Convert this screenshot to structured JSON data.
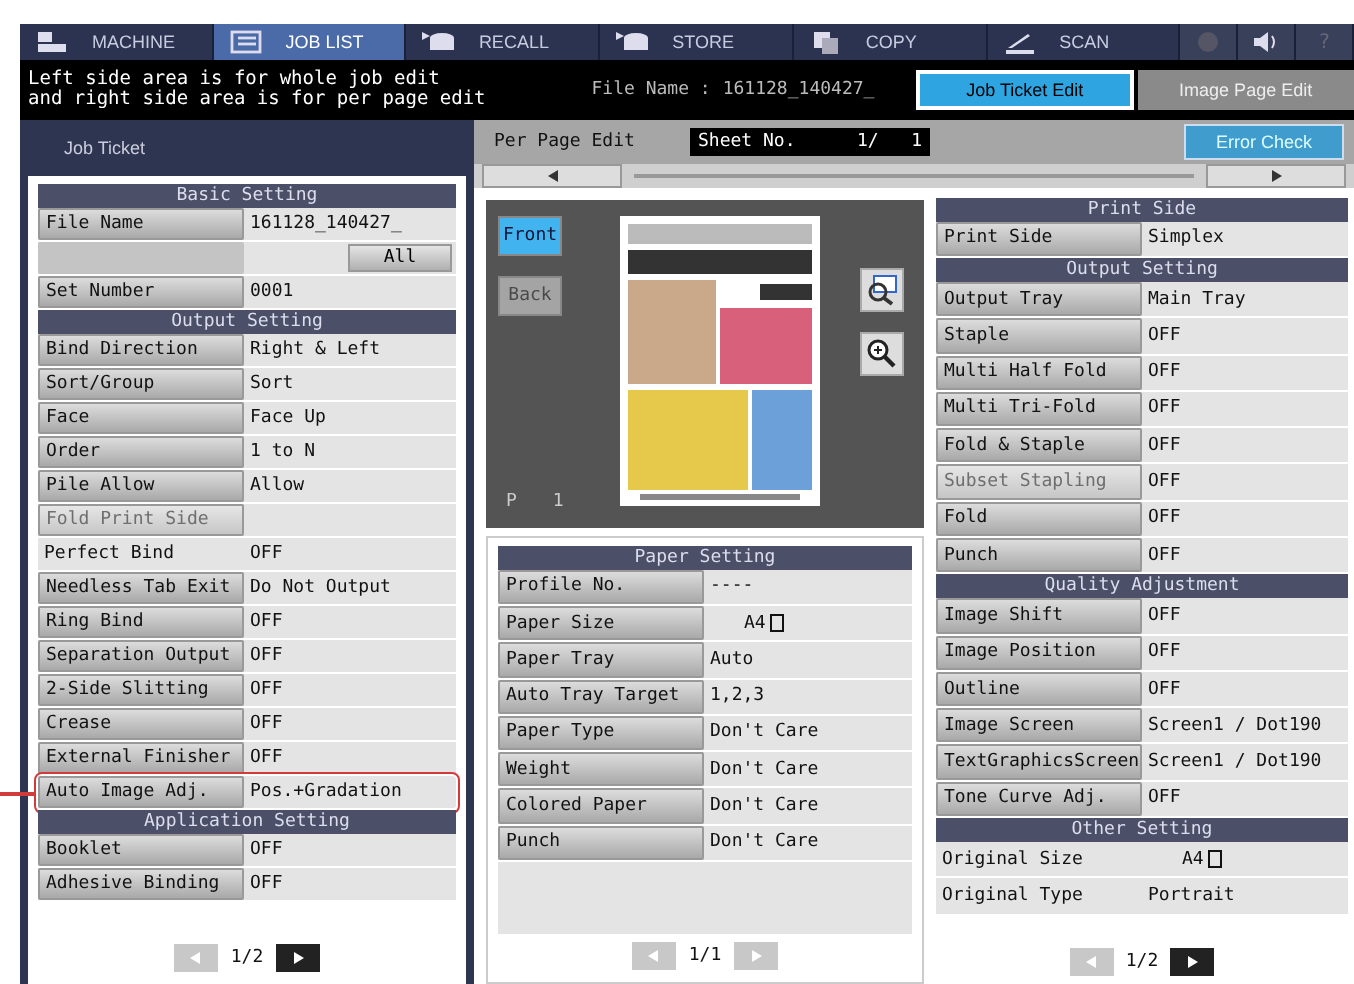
{
  "nav": [
    {
      "label": "MACHINE",
      "selected": false
    },
    {
      "label": "JOB LIST",
      "selected": true
    },
    {
      "label": "RECALL",
      "selected": false
    },
    {
      "label": "STORE",
      "selected": false
    },
    {
      "label": "COPY",
      "selected": false
    },
    {
      "label": "SCAN",
      "selected": false
    }
  ],
  "nav_buttons": [
    {
      "kind": "globe"
    },
    {
      "kind": "speaker"
    },
    {
      "kind": "help",
      "label": "?"
    }
  ],
  "message": [
    "Left side area is for whole job edit",
    "and right side area is for per page edit"
  ],
  "file_name": {
    "label": "File Name :",
    "value": "161128_140427_"
  },
  "tabs": [
    {
      "label": "Job Ticket Edit",
      "selected": true
    },
    {
      "label": "Image Page Edit",
      "selected": false
    }
  ],
  "job_ticket": {
    "title": "Job Ticket",
    "sections": [
      {
        "title": "Basic Setting",
        "rows": [
          {
            "kind": "setting",
            "label": "File Name",
            "value": "161128_140427_"
          },
          {
            "kind": "all",
            "value": "All"
          },
          {
            "kind": "setting",
            "label": "Set Number",
            "value": "0001"
          }
        ]
      },
      {
        "title": "Output Setting",
        "rows": [
          {
            "kind": "setting",
            "label": "Bind Direction",
            "value": "Right & Left"
          },
          {
            "kind": "setting",
            "label": "Sort/Group",
            "value": "Sort"
          },
          {
            "kind": "setting",
            "label": "Face",
            "value": "Face Up"
          },
          {
            "kind": "setting",
            "label": "Order",
            "value": "1 to N"
          },
          {
            "kind": "setting",
            "label": "Pile Allow",
            "value": "Allow"
          },
          {
            "kind": "setting",
            "label": "Fold Print Side",
            "disabled": true
          },
          {
            "kind": "info",
            "label": "Perfect Bind",
            "value": "OFF"
          },
          {
            "kind": "setting",
            "label": "Needless Tab Exit",
            "value": "Do Not Output"
          },
          {
            "kind": "setting",
            "label": "Ring Bind",
            "value": "OFF"
          },
          {
            "kind": "setting",
            "label": "Separation Output",
            "value": "OFF"
          },
          {
            "kind": "setting",
            "label": "2-Side Slitting",
            "value": "OFF"
          },
          {
            "kind": "setting",
            "label": "Crease",
            "value": "OFF"
          },
          {
            "kind": "setting",
            "label": "External Finisher",
            "value": "OFF"
          },
          {
            "kind": "setting",
            "label": "Auto Image Adj.",
            "value": "Pos.+Gradation",
            "highlighted": true
          }
        ]
      },
      {
        "title": "Application Setting",
        "rows": [
          {
            "kind": "setting",
            "label": "Booklet",
            "value": "OFF"
          },
          {
            "kind": "setting",
            "label": "Adhesive Binding",
            "value": "OFF"
          }
        ]
      }
    ],
    "pager": {
      "label": "1/2",
      "prev_enabled": false,
      "next_enabled": true
    }
  },
  "per_page": {
    "label": "Per Page Edit",
    "sheet_label": "Sheet No.",
    "sheet_value": "1/   1",
    "error_check": "Error Check"
  },
  "preview": {
    "sides": [
      {
        "label": "Front",
        "selected": true,
        "disabled": false
      },
      {
        "label": "Back",
        "selected": false,
        "disabled": true
      }
    ],
    "page_label": "P",
    "page_number": "1"
  },
  "paper_setting": {
    "sections": [
      {
        "title": "Paper Setting",
        "rows": [
          {
            "kind": "setting",
            "label": "Profile No.",
            "value": "----"
          },
          {
            "kind": "setting",
            "label": "Paper Size",
            "value": "A4",
            "paper_icon": true
          },
          {
            "kind": "setting",
            "label": "Paper Tray",
            "value": "Auto"
          },
          {
            "kind": "setting",
            "label": "Auto Tray Target",
            "value": "1,2,3"
          },
          {
            "kind": "setting",
            "label": "Paper Type",
            "value": "Don't Care"
          },
          {
            "kind": "setting",
            "label": "Weight",
            "value": "Don't Care"
          },
          {
            "kind": "setting",
            "label": "Colored Paper",
            "value": "Don't Care"
          },
          {
            "kind": "setting",
            "label": "Punch",
            "value": "Don't Care"
          }
        ]
      }
    ],
    "pager": {
      "label": "1/1",
      "prev_enabled": false,
      "next_enabled": false
    }
  },
  "page_settings": {
    "sections": [
      {
        "title": "Print Side",
        "rows": [
          {
            "kind": "setting",
            "label": "Print Side",
            "value": "Simplex"
          }
        ]
      },
      {
        "title": "Output Setting",
        "rows": [
          {
            "kind": "setting",
            "label": "Output Tray",
            "value": "Main Tray"
          },
          {
            "kind": "setting",
            "label": "Staple",
            "value": "OFF"
          },
          {
            "kind": "setting",
            "label": "Multi Half Fold",
            "value": "OFF"
          },
          {
            "kind": "setting",
            "label": "Multi Tri-Fold",
            "value": "OFF"
          },
          {
            "kind": "setting",
            "label": "Fold & Staple",
            "value": "OFF"
          },
          {
            "kind": "setting",
            "label": "Subset Stapling",
            "value": "OFF",
            "disabled": true
          },
          {
            "kind": "setting",
            "label": "Fold",
            "value": "OFF"
          },
          {
            "kind": "setting",
            "label": "Punch",
            "value": "OFF"
          }
        ]
      },
      {
        "title": "Quality Adjustment",
        "rows": [
          {
            "kind": "setting",
            "label": "Image Shift",
            "value": "OFF"
          },
          {
            "kind": "setting",
            "label": "Image Position",
            "value": "OFF"
          },
          {
            "kind": "setting",
            "label": "Outline",
            "value": "OFF"
          },
          {
            "kind": "setting",
            "label": "Image Screen",
            "value": "Screen1 / Dot190"
          },
          {
            "kind": "setting",
            "label": "TextGraphicsScreen",
            "value": "Screen1 / Dot190"
          },
          {
            "kind": "setting",
            "label": "Tone Curve Adj.",
            "value": "OFF"
          }
        ]
      },
      {
        "title": "Other Setting",
        "rows": [
          {
            "kind": "info",
            "label": "Original Size",
            "value": "A4",
            "paper_icon": true
          },
          {
            "kind": "info",
            "label": "Original Type",
            "value": "Portrait"
          }
        ]
      }
    ],
    "pager": {
      "label": "1/2",
      "prev_enabled": false,
      "next_enabled": true
    }
  }
}
